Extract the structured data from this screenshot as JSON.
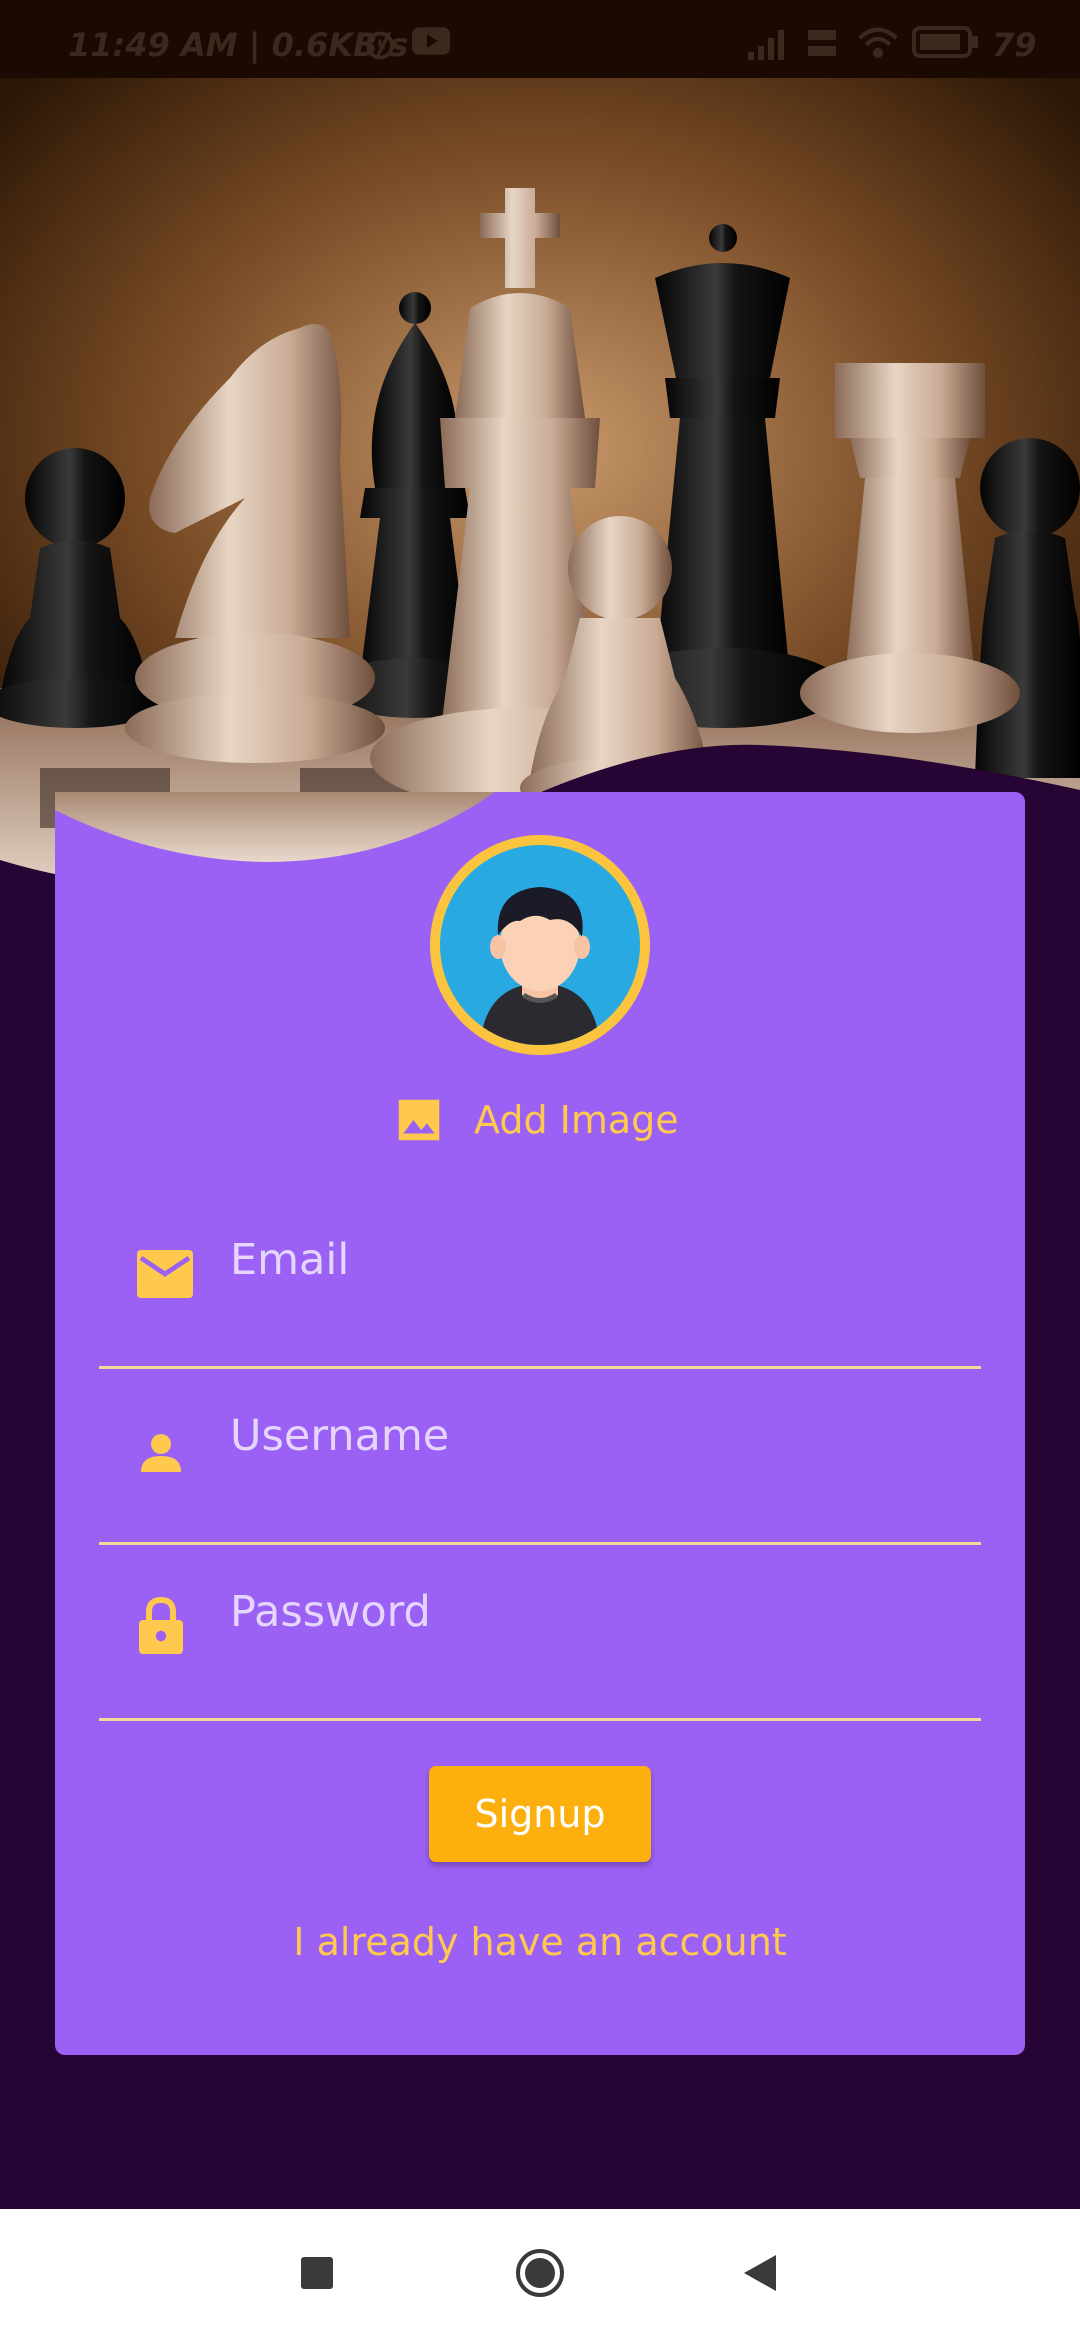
{
  "status_bar": {
    "time": "11:49 AM | 0.6KB/s",
    "battery": "79",
    "icons": [
      "alarm-icon",
      "youtube-icon",
      "signal-icon",
      "vowifi-icon",
      "wifi-icon",
      "battery-icon"
    ]
  },
  "signup": {
    "add_image_label": "Add Image",
    "email_placeholder": "Email",
    "username_placeholder": "Username",
    "password_placeholder": "Password",
    "signup_label": "Signup",
    "login_link_label": "I already have an account"
  },
  "nav_bar": {
    "icons": [
      "recents-icon",
      "home-icon",
      "back-icon"
    ]
  },
  "colors": {
    "background": "#260534",
    "card": "#9b61f5",
    "accent": "#ffc94e",
    "button": "#fcaf0d"
  }
}
